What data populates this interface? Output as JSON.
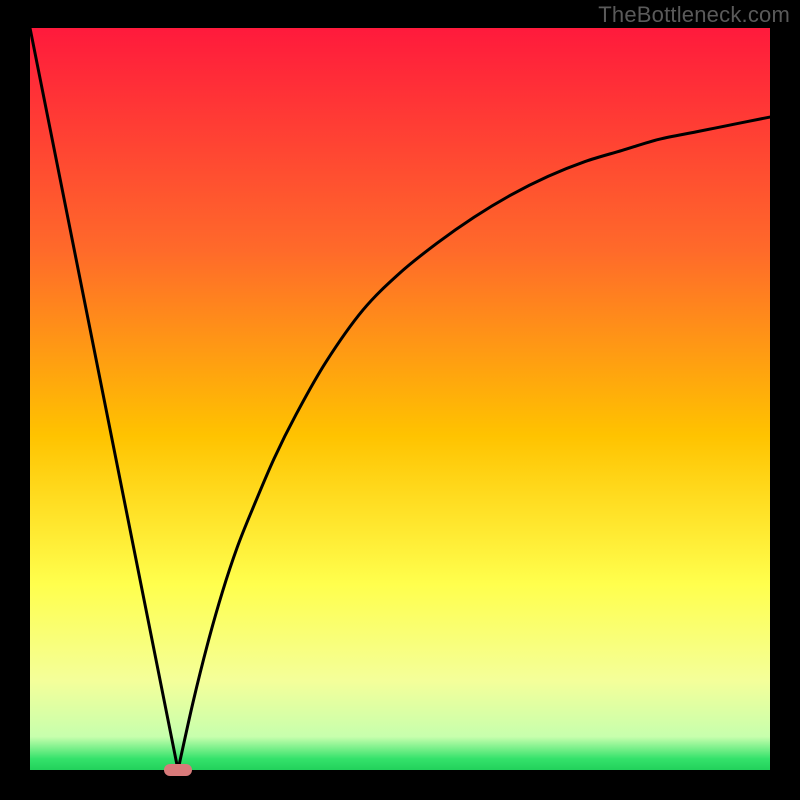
{
  "watermark": "TheBottleneck.com",
  "chart_data": {
    "type": "line",
    "title": "",
    "xlabel": "",
    "ylabel": "",
    "x_range": [
      0,
      100
    ],
    "y_range": [
      0,
      100
    ],
    "vertex_marker": {
      "x": 20,
      "color": "#d87a7a"
    },
    "gradient_stops": [
      {
        "offset": 0.0,
        "color": "#ff1a3c"
      },
      {
        "offset": 0.3,
        "color": "#ff6a2a"
      },
      {
        "offset": 0.55,
        "color": "#ffc300"
      },
      {
        "offset": 0.75,
        "color": "#ffff4d"
      },
      {
        "offset": 0.88,
        "color": "#f4ff9a"
      },
      {
        "offset": 0.955,
        "color": "#c7ffad"
      },
      {
        "offset": 0.985,
        "color": "#34e26b"
      },
      {
        "offset": 1.0,
        "color": "#22d15b"
      }
    ],
    "series": [
      {
        "name": "left-linear",
        "x": [
          0,
          20
        ],
        "values": [
          100,
          0
        ]
      },
      {
        "name": "right-curve",
        "x": [
          20,
          22,
          24,
          26,
          28,
          30,
          33,
          36,
          40,
          45,
          50,
          55,
          60,
          65,
          70,
          75,
          80,
          85,
          90,
          95,
          100
        ],
        "values": [
          0,
          9,
          17,
          24,
          30,
          35,
          42,
          48,
          55,
          62,
          67,
          71,
          74.5,
          77.5,
          80,
          82,
          83.5,
          85,
          86,
          87,
          88
        ]
      }
    ]
  }
}
